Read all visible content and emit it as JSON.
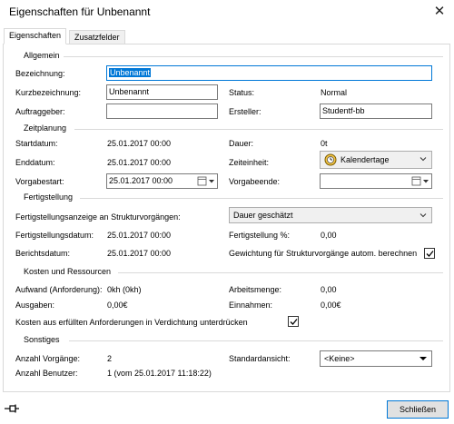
{
  "window": {
    "title": "Eigenschaften für Unbenannt",
    "close_glyph": "✕"
  },
  "tabs": [
    {
      "label": "Eigenschaften"
    },
    {
      "label": "Zusatzfelder"
    }
  ],
  "allgemein": {
    "header": "Allgemein",
    "bezeichnung_label": "Bezeichnung:",
    "bezeichnung_value": "Unbenannt",
    "kurz_label": "Kurzbezeichnung:",
    "kurz_value": "Unbenannt",
    "status_label": "Status:",
    "status_value": "Normal",
    "auftraggeber_label": "Auftraggeber:",
    "auftraggeber_value": "",
    "ersteller_label": "Ersteller:",
    "ersteller_value": "Studentf-bb"
  },
  "zeitplanung": {
    "header": "Zeitplanung",
    "startdatum_label": "Startdatum:",
    "startdatum_value": "25.01.2017 00:00",
    "dauer_label": "Dauer:",
    "dauer_value": "0t",
    "enddatum_label": "Enddatum:",
    "enddatum_value": "25.01.2017 00:00",
    "zeiteinheit_label": "Zeiteinheit:",
    "zeiteinheit_value": "Kalendertage",
    "vorgabestart_label": "Vorgabestart:",
    "vorgabestart_value": "25.01.2017 00:00",
    "vorgabeende_label": "Vorgabeende:",
    "vorgabeende_value": ""
  },
  "fertigstellung": {
    "header": "Fertigstellung",
    "anzeige_label": "Fertigstellungsanzeige an Strukturvorgängen:",
    "anzeige_value": "Dauer geschätzt",
    "datum_label": "Fertigstellungsdatum:",
    "datum_value": "25.01.2017 00:00",
    "prozent_label": "Fertigstellung %:",
    "prozent_value": "0,00",
    "berichtsdatum_label": "Berichtsdatum:",
    "berichtsdatum_value": "25.01.2017 00:00",
    "gewichtung_label": "Gewichtung für Strukturvorgänge autom. berechnen",
    "gewichtung_checked": true
  },
  "kosten": {
    "header": "Kosten und Ressourcen",
    "aufwand_label": "Aufwand (Anforderung):",
    "aufwand_value": "0kh (0kh)",
    "arbeitsmenge_label": "Arbeitsmenge:",
    "arbeitsmenge_value": "0,00",
    "ausgaben_label": "Ausgaben:",
    "ausgaben_value": "0,00€",
    "einnahmen_label": "Einnahmen:",
    "einnahmen_value": "0,00€",
    "unterdruecken_label": "Kosten aus erfüllten Anforderungen in Verdichtung unterdrücken",
    "unterdruecken_checked": true
  },
  "sonstiges": {
    "header": "Sonstiges",
    "vorgaenge_label": "Anzahl Vorgänge:",
    "vorgaenge_value": "2",
    "benutzer_label": "Anzahl Benutzer:",
    "benutzer_value": "1 (vom 25.01.2017 11:18:22)",
    "standardansicht_label": "Standardansicht:",
    "standardansicht_value": "<Keine>"
  },
  "footer": {
    "close_button": "Schließen",
    "pin_glyph": "⊣"
  }
}
